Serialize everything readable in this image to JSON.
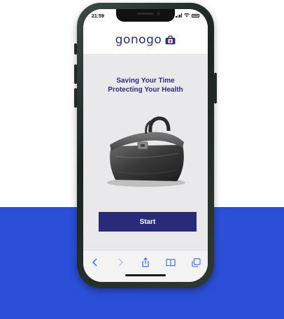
{
  "status_bar": {
    "time": "21:59",
    "icons": [
      "signal-icon",
      "wifi-icon",
      "battery-icon"
    ]
  },
  "app": {
    "brand": "gonogo",
    "brand_icon": "medical-bag-icon",
    "headline_line1": "Saving Your Time",
    "headline_line2": "Protecting Your Health",
    "hero_image": "doctor-bag",
    "start_label": "Start"
  },
  "browser_toolbar": {
    "items": [
      "back-icon",
      "forward-icon",
      "share-icon",
      "bookmarks-icon",
      "tabs-icon"
    ]
  },
  "colors": {
    "brand_navy": "#2a2d7c",
    "button": "#2a2a7a",
    "background_block": "#2b4fd8",
    "screen_bg": "#e9e9eb",
    "toolbar_icon": "#2f6bff"
  }
}
